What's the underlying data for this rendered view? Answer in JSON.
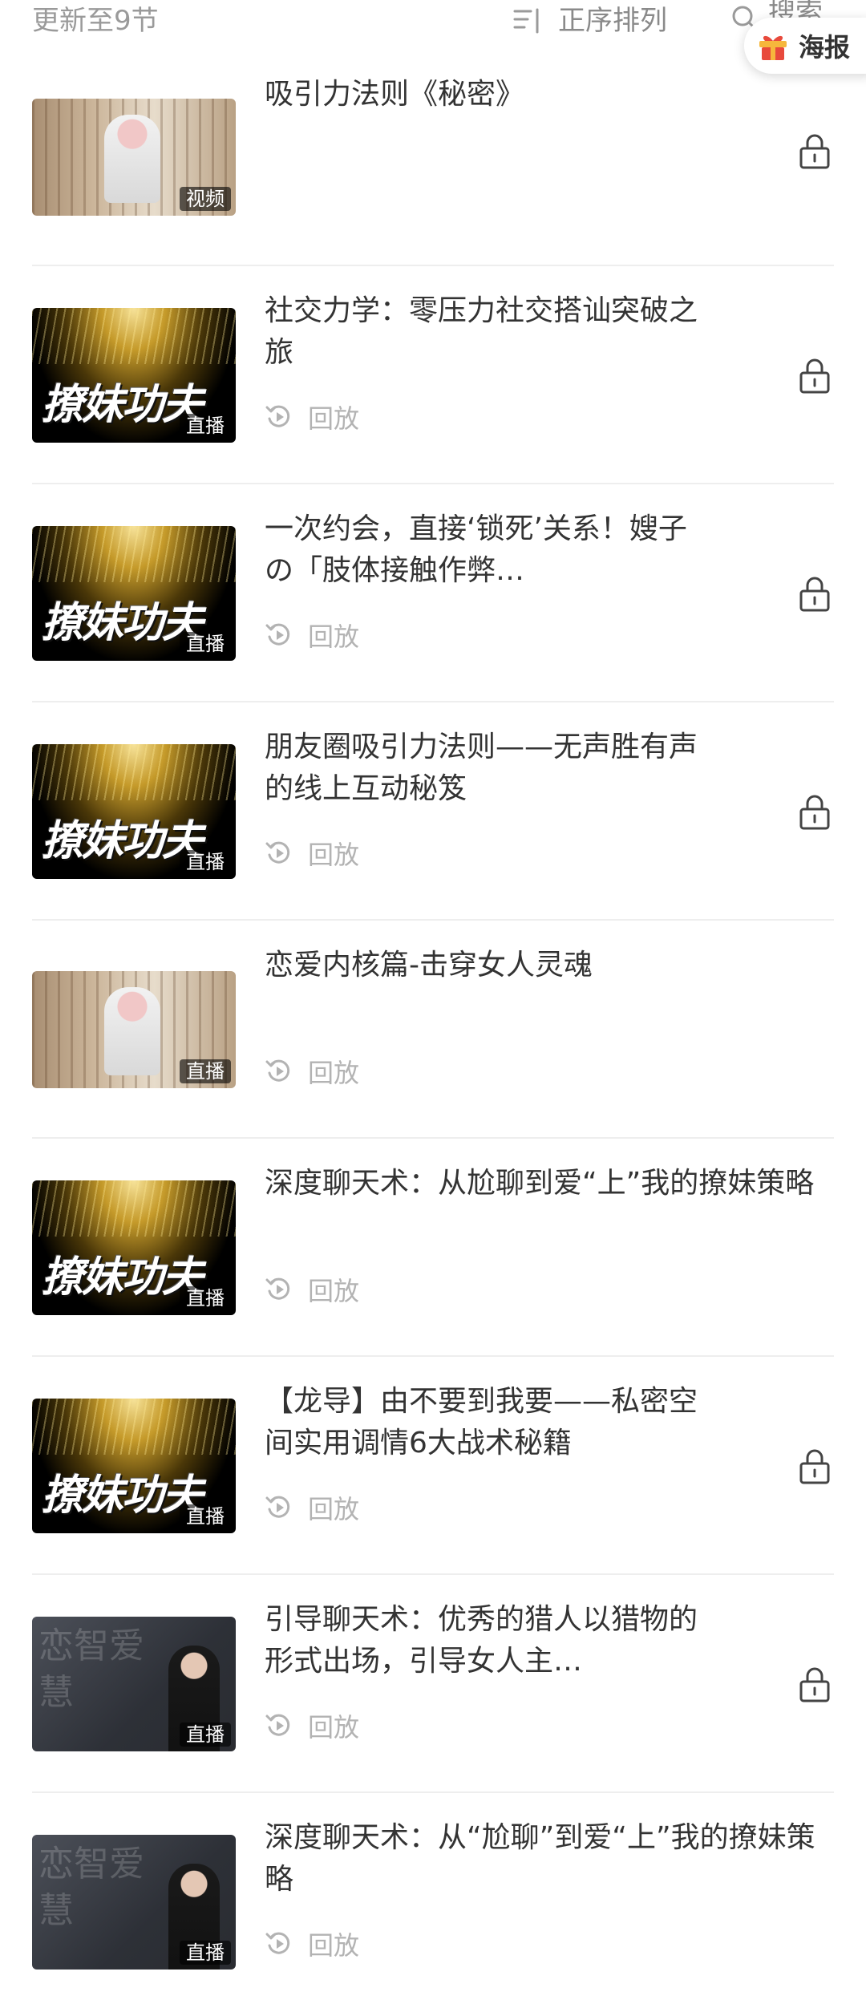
{
  "header": {
    "update_status": "更新至9节",
    "sort_label": "正序排列",
    "search_label": "搜索",
    "poster_label": "海报",
    "icons": [
      "sort-icon",
      "search-icon",
      "gift-icon"
    ]
  },
  "colors": {
    "text_primary": "#333333",
    "text_secondary": "#9a9a9a",
    "text_muted": "#b3b3b3",
    "divider": "#eeeeee",
    "gift_red": "#e84a3c",
    "gift_yellow": "#f6b73c"
  },
  "lessons": [
    {
      "title": "吸引力法则《秘密》",
      "tag": "视频",
      "thumb": "room",
      "replay": "",
      "locked": true
    },
    {
      "title": "社交力学：零压力社交搭讪突破之旅",
      "tag": "直播",
      "thumb": "gold",
      "logo": "撩妹功夫",
      "replay": "回放",
      "locked": true
    },
    {
      "title": "一次约会，直接‘锁死’关系！嫂子の「肢体接触作弊…",
      "tag": "直播",
      "thumb": "gold",
      "logo": "撩妹功夫",
      "replay": "回放",
      "locked": true
    },
    {
      "title": "朋友圈吸引力法则——无声胜有声的线上互动秘笈",
      "tag": "直播",
      "thumb": "gold",
      "logo": "撩妹功夫",
      "replay": "回放",
      "locked": true
    },
    {
      "title": "恋爱内核篇-击穿女人灵魂",
      "tag": "直播",
      "thumb": "room",
      "replay": "回放",
      "locked": false
    },
    {
      "title": "深度聊天术：从尬聊到爱“上”我的撩妹策略",
      "tag": "直播",
      "thumb": "gold",
      "logo": "撩妹功夫",
      "replay": "回放",
      "locked": false
    },
    {
      "title": "【龙导】由不要到我要——私密空间实用调情6大战术秘籍",
      "tag": "直播",
      "thumb": "gold",
      "logo": "撩妹功夫",
      "replay": "回放",
      "locked": true
    },
    {
      "title": "引导聊天术：优秀的猎人以猎物的形式出场，引导女人主…",
      "tag": "直播",
      "thumb": "dark",
      "brush": "恋智爱慧",
      "replay": "回放",
      "locked": true
    },
    {
      "title": "深度聊天术：从“尬聊”到爱“上”我的撩妹策略",
      "tag": "直播",
      "thumb": "dark",
      "brush": "恋智爱慧",
      "replay": "回放",
      "locked": false
    }
  ]
}
